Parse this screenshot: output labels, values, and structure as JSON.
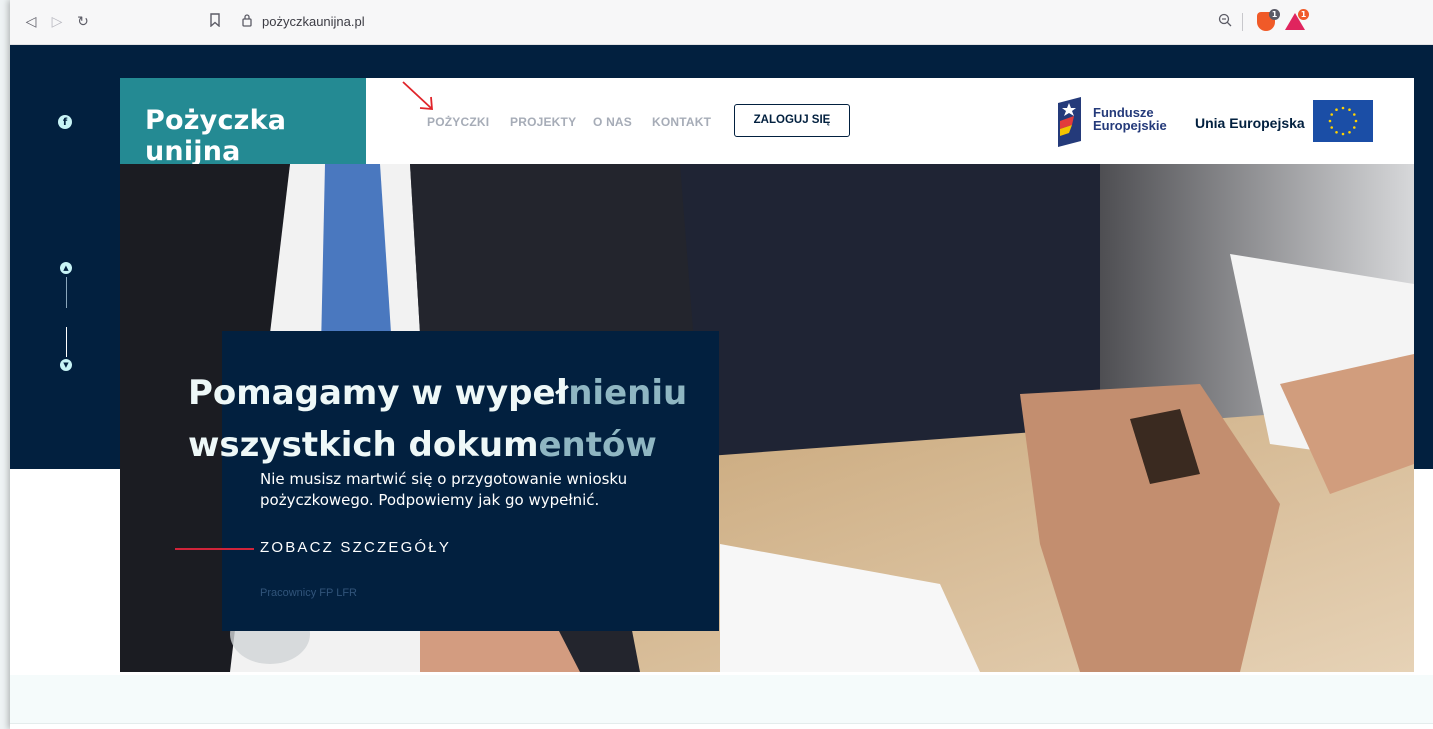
{
  "browser": {
    "url": "pożyczkaunijna.pl",
    "brave_badge": "1",
    "alert_badge": "1"
  },
  "site": {
    "logo_text": "Pożyczka unijna",
    "nav": [
      "POŻYCZKI",
      "PROJEKTY",
      "O NAS",
      "KONTAKT"
    ],
    "login_label": "ZALOGUJ SIĘ",
    "fe_line1": "Fundusze",
    "fe_line2": "Europejskie",
    "ue_label": "Unia Europejska"
  },
  "hero": {
    "title_line1": "Pomagamy w wypeł",
    "title_line1_faded": "nieniu",
    "title_line2": "wszystkich dokum",
    "title_line2_faded": "entów",
    "description": "Nie musisz martwić się o przygotowanie wniosku pożyczkowego. Podpowiemy jak go wypełnić.",
    "cta": "ZOBACZ SZCZEGÓŁY",
    "caption": "Pracownicy FP LFR"
  },
  "colors": {
    "navy": "#02203f",
    "teal": "#248a93",
    "accent_red": "#d0243a",
    "nav_grey": "#a6acb7"
  }
}
